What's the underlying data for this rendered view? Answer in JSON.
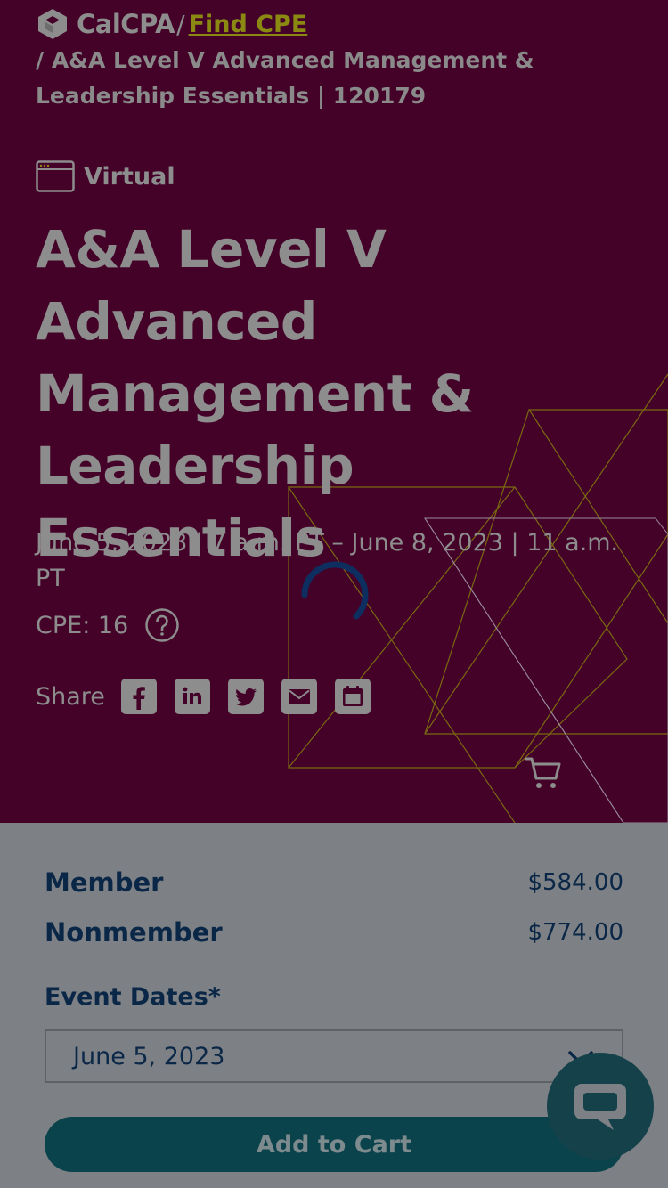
{
  "brand": {
    "logo_text": "CalCPA"
  },
  "breadcrumb": {
    "separator": "/",
    "link_label": "Find CPE",
    "current": "/ A&A Level V Advanced Management & Leadership Essentials | 120179"
  },
  "event": {
    "format": "Virtual",
    "title": "A&A Level V Advanced Management & Leadership Essentials",
    "dates": "June 5, 2023 | 7 a.m. PT – June 8, 2023 | 11 a.m. PT",
    "cpe": "CPE: 16"
  },
  "share": {
    "label": "Share",
    "buttons": [
      "facebook-icon",
      "linkedin-icon",
      "twitter-icon",
      "email-icon",
      "calendar-icon"
    ]
  },
  "pricing": {
    "member_label": "Member",
    "member_price": "$584.00",
    "nonmember_label": "Nonmember",
    "nonmember_price": "$774.00"
  },
  "registration": {
    "dates_label": "Event Dates*",
    "selected_date": "June 5, 2023",
    "add_to_cart": "Add to Cart"
  },
  "colors": {
    "hero_bg": "#440229",
    "overlay_text": "#8d8d8d",
    "accent_link": "#8a8a12",
    "panel_bg": "#7d8185",
    "navy": "#0a2747",
    "button_bg": "#0b434c"
  }
}
